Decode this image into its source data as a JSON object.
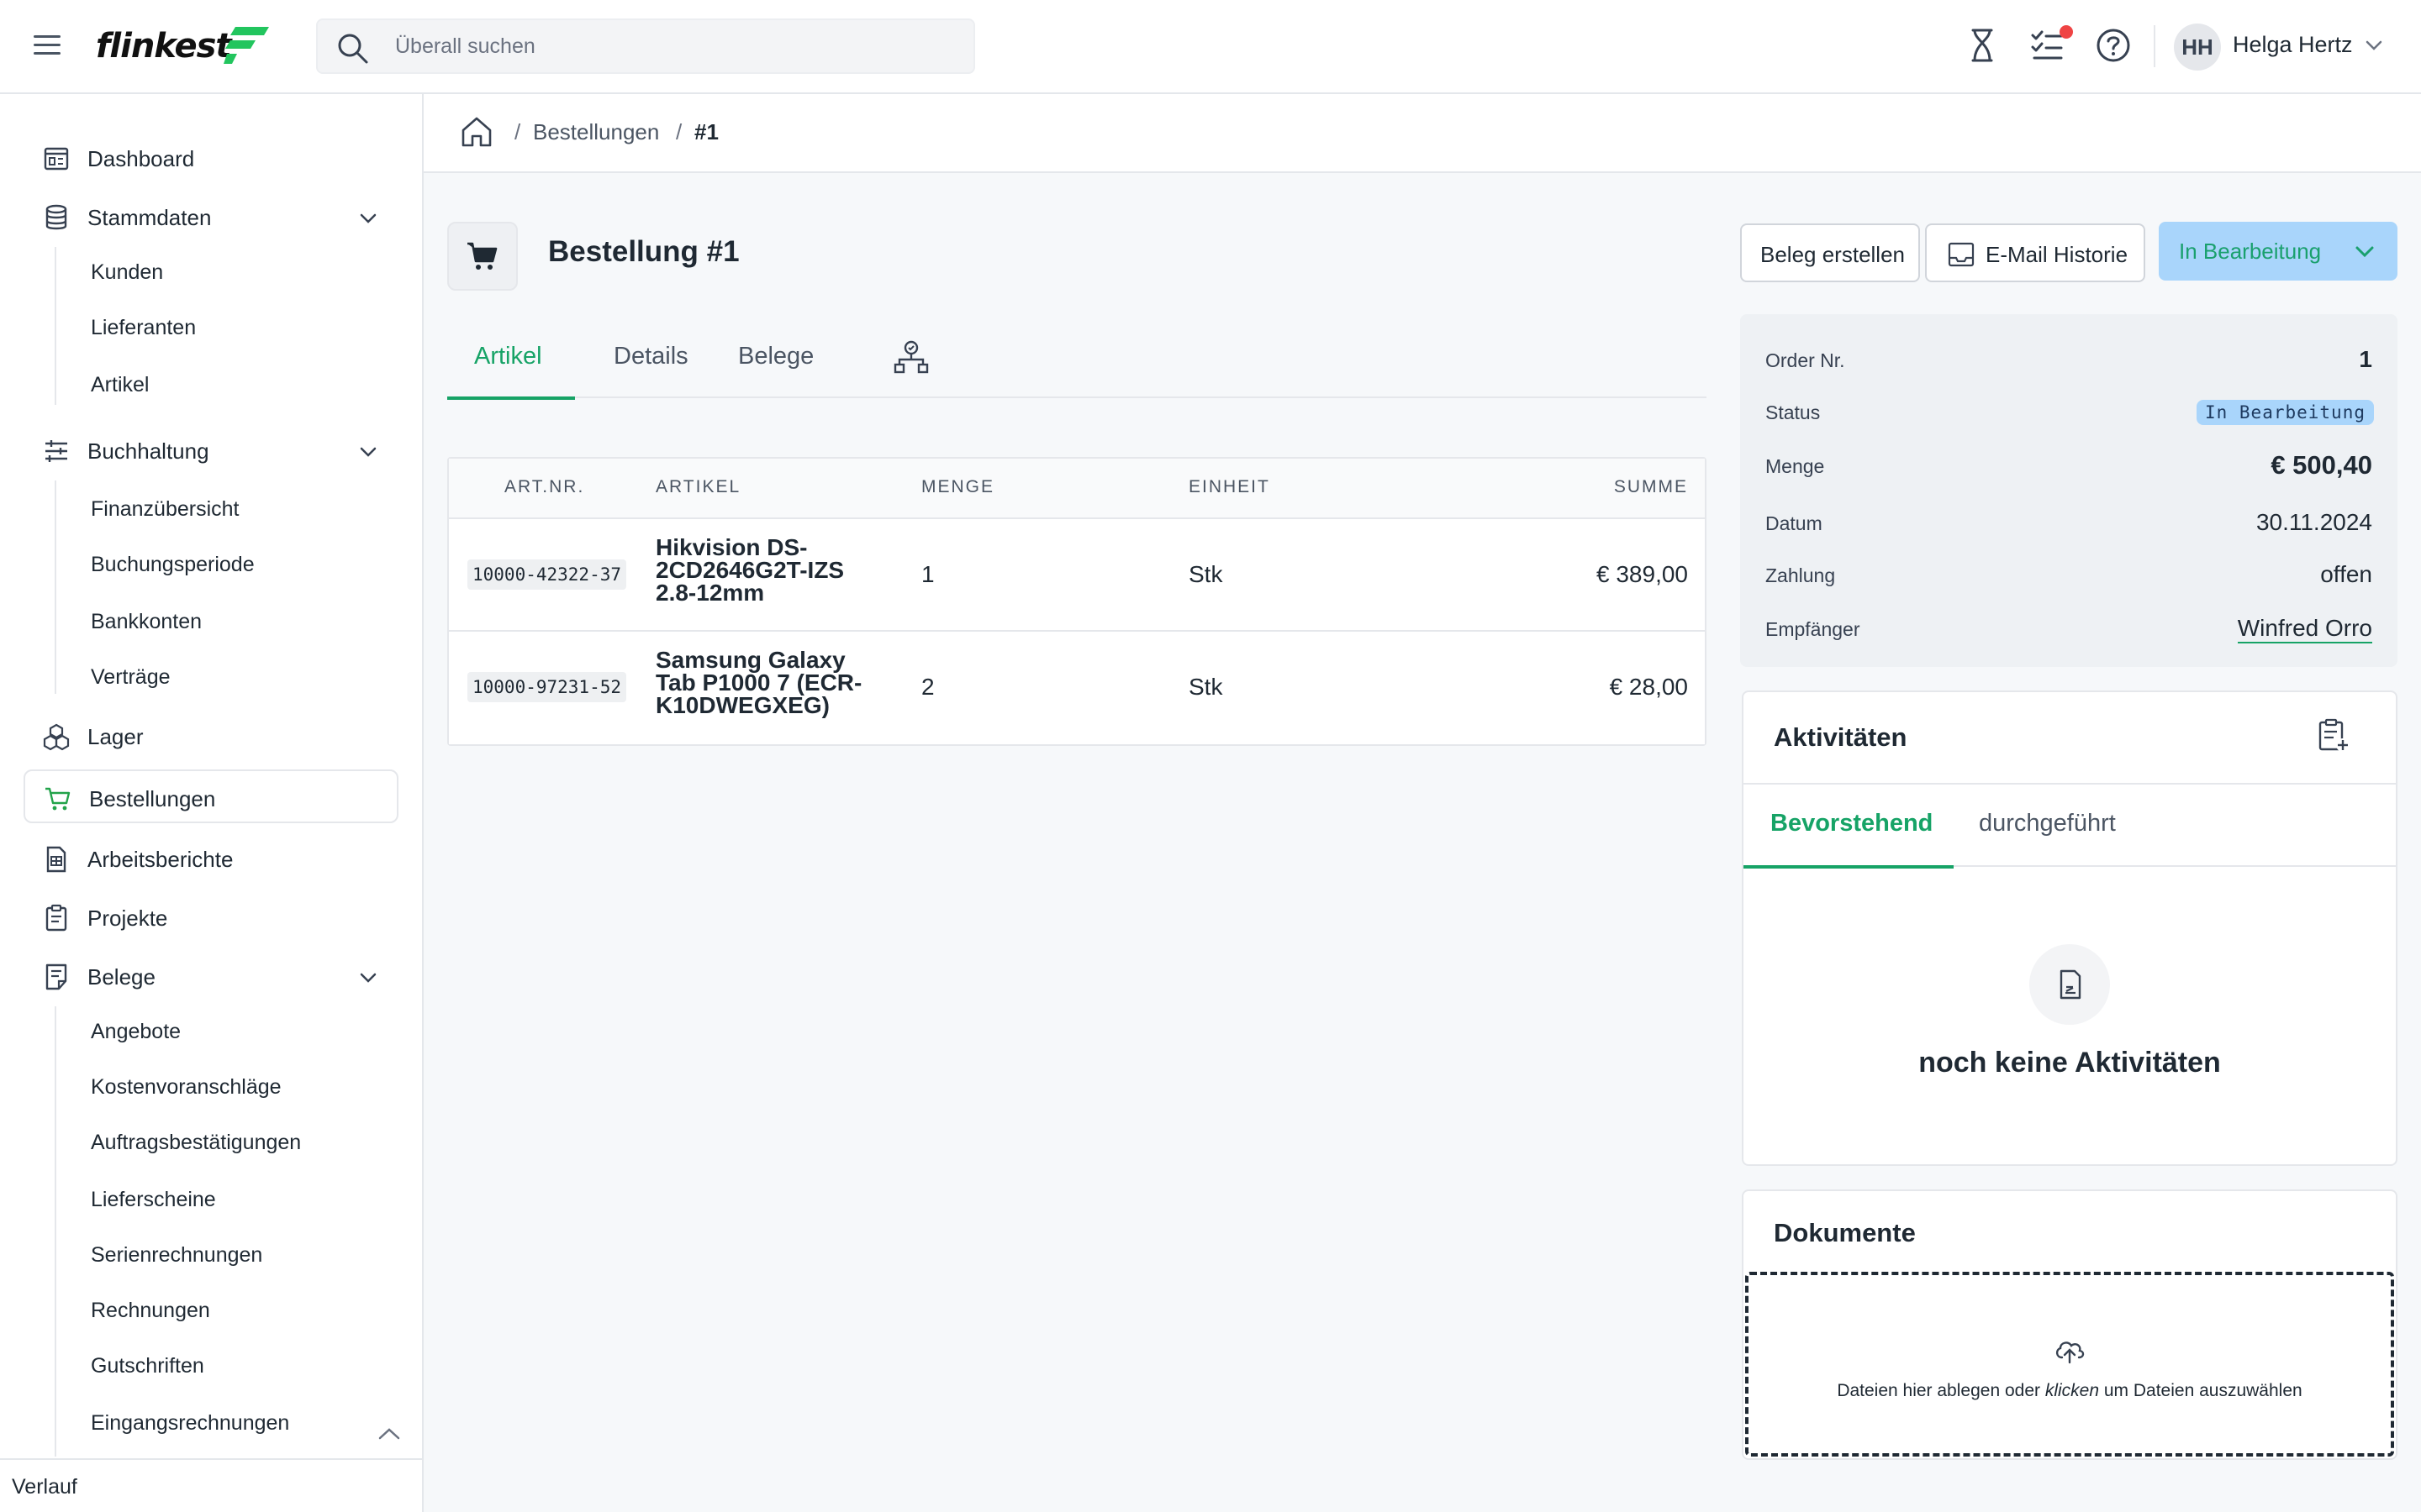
{
  "header": {
    "logo_text": "flinkest",
    "search_placeholder": "Überall suchen",
    "user": {
      "initials": "HH",
      "name": "Helga Hertz"
    }
  },
  "sidebar": {
    "items": [
      {
        "label": "Dashboard"
      },
      {
        "label": "Stammdaten",
        "children": [
          "Kunden",
          "Lieferanten",
          "Artikel"
        ]
      },
      {
        "label": "Buchhaltung",
        "children": [
          "Finanzübersicht",
          "Buchungsperiode",
          "Bankkonten",
          "Verträge"
        ]
      },
      {
        "label": "Lager"
      },
      {
        "label": "Bestellungen"
      },
      {
        "label": "Arbeitsberichte"
      },
      {
        "label": "Projekte"
      },
      {
        "label": "Belege",
        "children": [
          "Angebote",
          "Kostenvoranschläge",
          "Auftragsbestätigungen",
          "Lieferscheine",
          "Serienrechnungen",
          "Rechnungen",
          "Gutschriften",
          "Eingangsrechnungen"
        ]
      }
    ],
    "footer_label": "Verlauf"
  },
  "breadcrumb": {
    "items": [
      "Bestellungen",
      "#1"
    ]
  },
  "page": {
    "title": "Bestellung #1",
    "buttons": {
      "create_doc": "Beleg erstellen",
      "email_history": "E-Mail Historie",
      "status": "In Bearbeitung"
    },
    "tabs": [
      "Artikel",
      "Details",
      "Belege"
    ]
  },
  "table": {
    "headers": [
      "ART.NR.",
      "ARTIKEL",
      "MENGE",
      "EINHEIT",
      "SUMME"
    ],
    "rows": [
      {
        "artnr": "10000-42322-37",
        "artikel": "Hikvision DS-2CD2646G2T-IZS 2.8-12mm",
        "menge": "1",
        "einheit": "Stk",
        "summe": "€ 389,00"
      },
      {
        "artnr": "10000-97231-52",
        "artikel": "Samsung Galaxy Tab P1000 7 (ECR-K10DWEGXEG)",
        "menge": "2",
        "einheit": "Stk",
        "summe": "€ 28,00"
      }
    ]
  },
  "info": {
    "order_nr": {
      "label": "Order Nr.",
      "value": "1"
    },
    "status": {
      "label": "Status",
      "value": "In Bearbeitung"
    },
    "menge": {
      "label": "Menge",
      "value": "€ 500,40"
    },
    "datum": {
      "label": "Datum",
      "value": "30.11.2024"
    },
    "zahlung": {
      "label": "Zahlung",
      "value": "offen"
    },
    "empfaenger": {
      "label": "Empfänger",
      "value": "Winfred Orro"
    }
  },
  "activities": {
    "title": "Aktivitäten",
    "tabs": [
      "Bevorstehend",
      "durchgeführt"
    ],
    "empty_text": "noch keine Aktivitäten"
  },
  "documents": {
    "title": "Dokumente",
    "drop_before": "Dateien hier ablegen oder ",
    "drop_emph": "klicken",
    "drop_after": " um Dateien auszuwählen"
  },
  "colors": {
    "accent": "#16a366",
    "status_bg": "#a9d5fb",
    "notification": "#ef4444"
  }
}
